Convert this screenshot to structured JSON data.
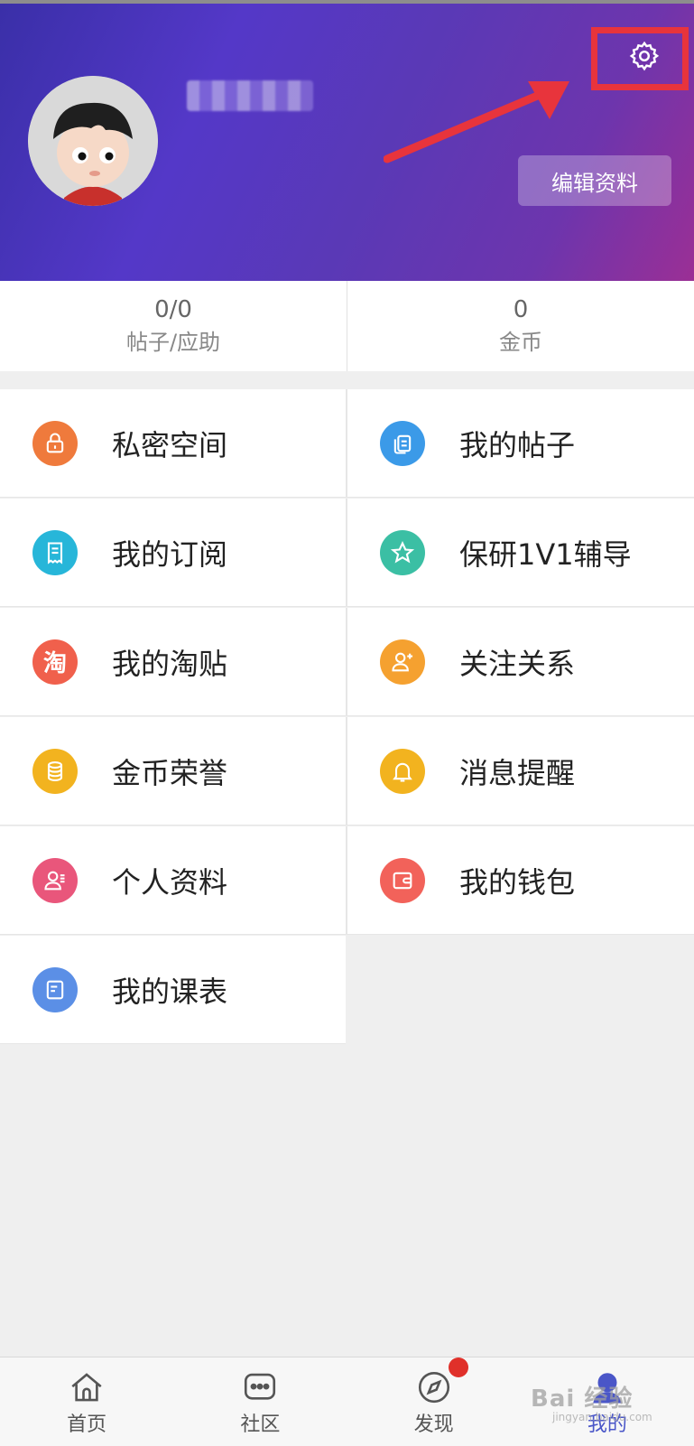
{
  "header": {
    "edit_label": "编辑资料",
    "colors": {
      "gradient_start": "#3a2fa8",
      "gradient_end": "#9b2f95",
      "highlight": "#e8343c"
    }
  },
  "stats": [
    {
      "value": "0/0",
      "label": "帖子/应助"
    },
    {
      "value": "0",
      "label": "金币"
    }
  ],
  "menu": [
    {
      "label": "私密空间",
      "icon": "lock-icon",
      "color": "#ef7a3c"
    },
    {
      "label": "我的帖子",
      "icon": "document-copy-icon",
      "color": "#3b9ae8"
    },
    {
      "label": "我的订阅",
      "icon": "receipt-icon",
      "color": "#27b6d9"
    },
    {
      "label": "保研1V1辅导",
      "icon": "star-icon",
      "color": "#3bbfa4"
    },
    {
      "label": "我的淘贴",
      "icon": "tao-icon",
      "color": "#f0604c"
    },
    {
      "label": "关注关系",
      "icon": "follow-user-icon",
      "color": "#f5a130"
    },
    {
      "label": "金币荣誉",
      "icon": "coin-stack-icon",
      "color": "#f2b31f"
    },
    {
      "label": "消息提醒",
      "icon": "bell-icon",
      "color": "#f2b31f"
    },
    {
      "label": "个人资料",
      "icon": "profile-icon",
      "color": "#e9567b"
    },
    {
      "label": "我的钱包",
      "icon": "wallet-icon",
      "color": "#f2625a"
    },
    {
      "label": "我的课表",
      "icon": "schedule-icon",
      "color": "#5b8fe6"
    }
  ],
  "tabbar": [
    {
      "label": "首页",
      "icon": "home-icon"
    },
    {
      "label": "社区",
      "icon": "chat-icon"
    },
    {
      "label": "发现",
      "icon": "compass-icon"
    },
    {
      "label": "我的",
      "icon": "profile-icon",
      "active": true
    }
  ],
  "watermark": {
    "main": "Bai 经验",
    "sub": "jingyan.baidu.com"
  }
}
